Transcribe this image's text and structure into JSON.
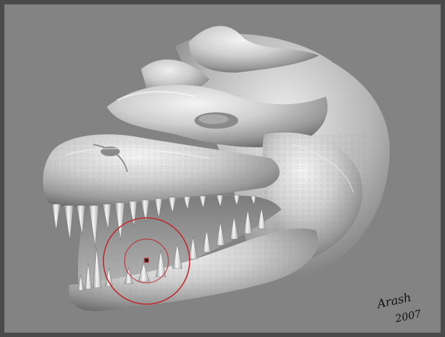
{
  "signature": {
    "name": "Arash",
    "year": "2007"
  },
  "colors": {
    "canvas_bg": "#838383",
    "sculpt_light": "#f2f2f2",
    "sculpt_mid": "#bdbdbd",
    "sculpt_dark": "#6f6f6f",
    "brush_ring": "#c0262a"
  },
  "icons": {
    "brush_cursor": "brush-cursor-icon",
    "brush_center": "brush-center-marker-icon"
  }
}
